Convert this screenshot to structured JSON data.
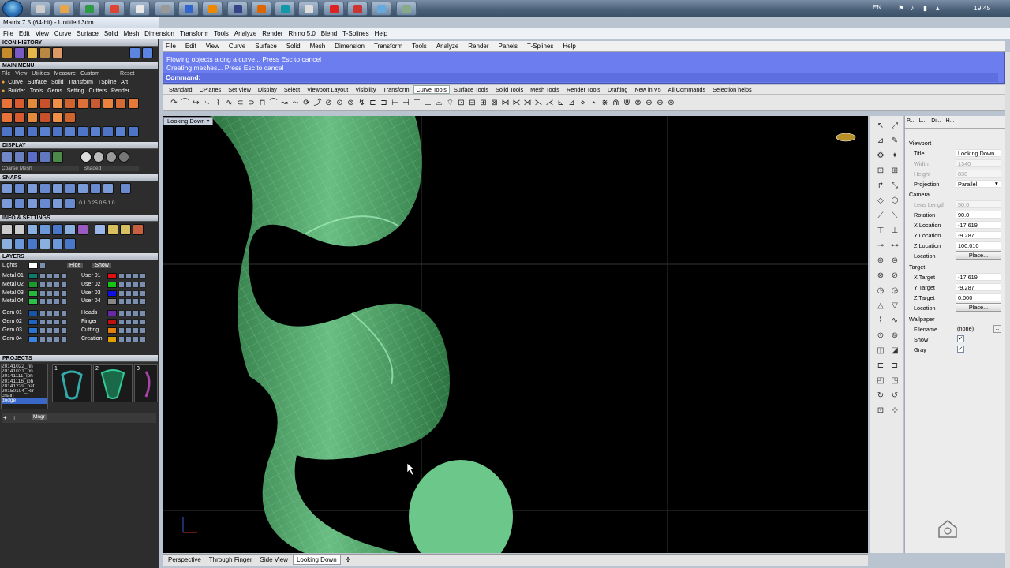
{
  "taskbar": {
    "clock": "19:45",
    "language": "EN"
  },
  "window": {
    "title": "Matrix 7.5 (64-bit) - Untitled.3dm"
  },
  "main_menu": [
    "File",
    "Edit",
    "View",
    "Curve",
    "Surface",
    "Solid",
    "Mesh",
    "Dimension",
    "Transform",
    "Tools",
    "Analyze",
    "Render",
    "Rhino 5.0",
    "Blend",
    "T-Splines",
    "Help"
  ],
  "left_panel": {
    "icon_history": "ICON HISTORY",
    "main_menu_title": "MAIN MENU",
    "main_menu_links": [
      "File",
      "View",
      "Utilities",
      "Measure",
      "Custom"
    ],
    "reset": "Reset",
    "cat_row1": [
      "Curve",
      "Surface",
      "Solid",
      "Transform",
      "TSpline",
      "Art"
    ],
    "cat_row2": [
      "Builder",
      "Tools",
      "Gems",
      "Setting",
      "Cutters",
      "Render"
    ],
    "display_title": "DISPLAY",
    "display_mode1": "Coarse Mesh",
    "display_mode2": "Shaded",
    "snaps_title": "SNAPS",
    "snap_values": [
      "0.1",
      "0.25",
      "0.5",
      "1.0"
    ],
    "info_title": "INFO & SETTINGS",
    "layers_title": "LAYERS",
    "lights": "Lights",
    "hide": "Hide",
    "show": "Show",
    "layers_left": [
      {
        "name": "Metal 01",
        "color": "#0e7a6b"
      },
      {
        "name": "Metal 02",
        "color": "#1a9c2c"
      },
      {
        "name": "Metal 03",
        "color": "#25b83a"
      },
      {
        "name": "Metal 04",
        "color": "#2ac04a"
      },
      {
        "name": "Gem 01",
        "color": "#1656a8"
      },
      {
        "name": "Gem 02",
        "color": "#1e64c0"
      },
      {
        "name": "Gem 03",
        "color": "#2a74d0"
      },
      {
        "name": "Gem 04",
        "color": "#3a84e0"
      }
    ],
    "layers_right": [
      {
        "name": "User 01",
        "color": "#e01010"
      },
      {
        "name": "User 02",
        "color": "#12c612"
      },
      {
        "name": "User 03",
        "color": "#1010e0"
      },
      {
        "name": "User 04",
        "color": "#888888"
      },
      {
        "name": "Heads",
        "color": "#6a28a8"
      },
      {
        "name": "Finger",
        "color": "#c01010"
      },
      {
        "name": "Cutting",
        "color": "#e08010"
      },
      {
        "name": "Creation",
        "color": "#e0a000"
      }
    ],
    "projects_title": "PROJECTS",
    "projects": [
      "20141022_rin",
      "20141031_rin",
      "20141111_iph",
      "20141116_iph",
      "20141229_pat",
      "20150104_Rir",
      "chain",
      "dodge"
    ],
    "project_selected": "dodge",
    "thumbnails": [
      "1",
      "2",
      "3"
    ],
    "mngr": "Mngr"
  },
  "rhino": {
    "menu": [
      "File",
      "Edit",
      "View",
      "Curve",
      "Surface",
      "Solid",
      "Mesh",
      "Dimension",
      "Transform",
      "Tools",
      "Analyze",
      "Render",
      "Panels",
      "T-Splines",
      "Help"
    ],
    "history": [
      "Flowing objects along a curve... Press Esc to cancel",
      "Creating meshes... Press Esc to cancel"
    ],
    "command_label": "Command:",
    "toolbar_tabs": [
      "Standard",
      "CPlanes",
      "Set View",
      "Display",
      "Select",
      "Viewport Layout",
      "Visibility",
      "Transform",
      "Curve Tools",
      "Surface Tools",
      "Solid Tools",
      "Mesh Tools",
      "Render Tools",
      "Drafting",
      "New in V5",
      "All Commands",
      "Selection helps"
    ],
    "active_tab": "Curve Tools",
    "viewport_title": "Looking Down",
    "viewport_tabs": [
      "Perspective",
      "Through Finger",
      "Side View",
      "Looking Down"
    ],
    "active_viewport": "Looking Down"
  },
  "properties": {
    "tabs": [
      "P...",
      "L...",
      "Di...",
      "H..."
    ],
    "viewport_group": "Viewport",
    "title_label": "Title",
    "title_value": "Looking Down",
    "width_label": "Width",
    "width_value": "1340",
    "height_label": "Height",
    "height_value": "830",
    "projection_label": "Projection",
    "projection_value": "Parallel",
    "camera_group": "Camera",
    "lens_label": "Lens Length",
    "lens_value": "50.0",
    "rotation_label": "Rotation",
    "rotation_value": "90.0",
    "xloc_label": "X Location",
    "xloc_value": "-17.619",
    "yloc_label": "Y Location",
    "yloc_value": "-9.287",
    "zloc_label": "Z Location",
    "zloc_value": "100.010",
    "location_label": "Location",
    "place_button": "Place...",
    "target_group": "Target",
    "xt_label": "X Target",
    "xt_value": "-17.619",
    "yt_label": "Y Target",
    "yt_value": "-9.287",
    "zt_label": "Z Target",
    "zt_value": "0.000",
    "tlocation_label": "Location",
    "tplace_button": "Place...",
    "wallpaper_group": "Wallpaper",
    "filename_label": "Filename",
    "filename_value": "(none)",
    "show_label": "Show",
    "gray_label": "Gray"
  },
  "colors": {
    "command_bg": "#6c7df0",
    "mesh_green": "#5fb87a",
    "viewport_bg": "#000000"
  }
}
